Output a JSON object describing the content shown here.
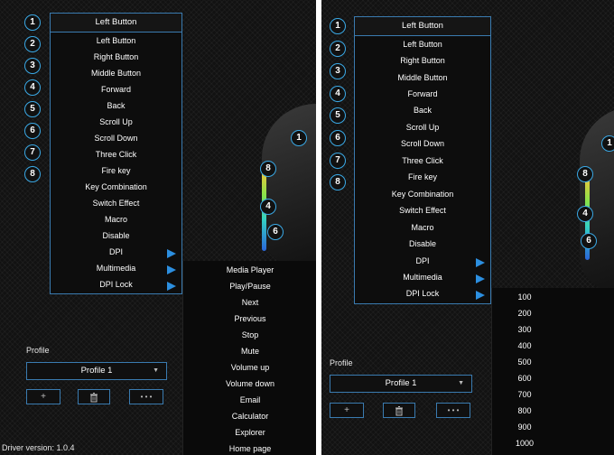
{
  "panel_a": {
    "selected": "Left Button",
    "numbers": [
      "1",
      "2",
      "3",
      "4",
      "5",
      "6",
      "7",
      "8"
    ],
    "menu": [
      "Left Button",
      "Right Button",
      "Middle Button",
      "Forward",
      "Back",
      "Scroll Up",
      "Scroll Down",
      "Three Click",
      "Fire key",
      "Key Combination",
      "Switch Effect",
      "Macro",
      "Disable",
      "DPI",
      "Multimedia",
      "DPI Lock"
    ],
    "submenu": [
      "Media Player",
      "Play/Pause",
      "Next",
      "Previous",
      "Stop",
      "Mute",
      "Volume up",
      "Volume down",
      "Email",
      "Calculator",
      "Explorer",
      "Home page"
    ],
    "mouse_markers": [
      "1",
      "8",
      "4",
      "6"
    ],
    "profile_label": "Profile",
    "profile_value": "Profile 1",
    "add_label": "+",
    "more_label": "• • •",
    "driver_version": "Driver version: 1.0.4"
  },
  "panel_b": {
    "selected": "Left Button",
    "numbers": [
      "1",
      "2",
      "3",
      "4",
      "5",
      "6",
      "7",
      "8"
    ],
    "menu": [
      "Left Button",
      "Right Button",
      "Middle Button",
      "Forward",
      "Back",
      "Scroll Up",
      "Scroll Down",
      "Three Click",
      "Fire key",
      "Key Combination",
      "Switch Effect",
      "Macro",
      "Disable",
      "DPI",
      "Multimedia",
      "DPI Lock"
    ],
    "dpi_values": [
      "100",
      "200",
      "300",
      "400",
      "500",
      "600",
      "700",
      "800",
      "900",
      "1000"
    ],
    "mouse_markers": [
      "1",
      "8",
      "4",
      "6"
    ],
    "profile_label": "Profile",
    "profile_value": "Profile 1",
    "add_label": "+",
    "more_label": "• • •"
  },
  "colors": {
    "accent": "#2c8fe0",
    "border": "#3a7bb0",
    "ring": "#3aa9e6"
  }
}
